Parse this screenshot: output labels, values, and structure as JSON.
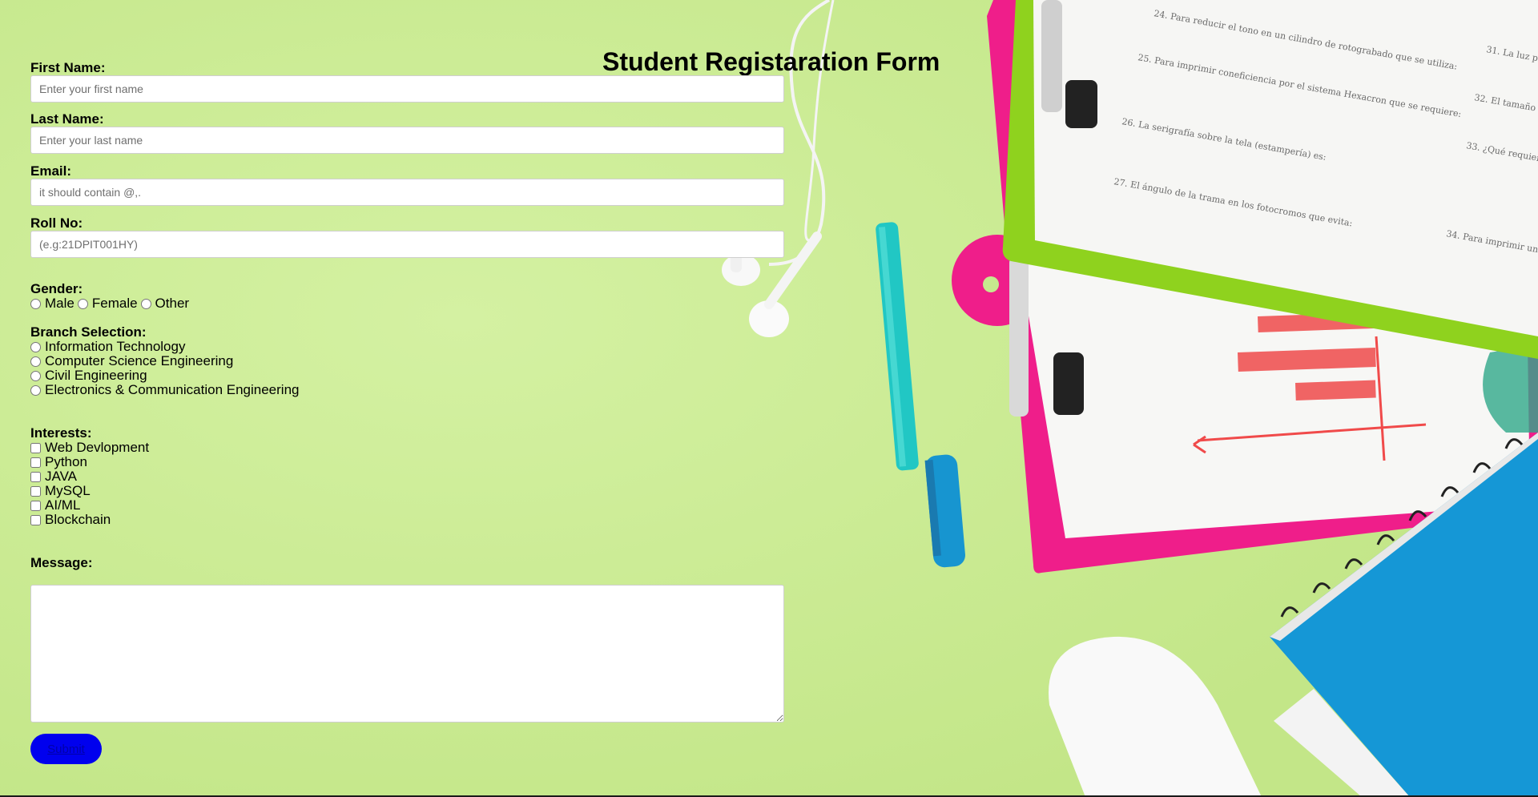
{
  "page": {
    "title": "Student Registaration Form"
  },
  "form": {
    "first_name": {
      "label": "First Name:",
      "placeholder": "Enter your first name",
      "value": ""
    },
    "last_name": {
      "label": "Last Name:",
      "placeholder": "Enter your last name",
      "value": ""
    },
    "email": {
      "label": "Email:",
      "placeholder": "it should contain @,.",
      "value": ""
    },
    "roll_no": {
      "label": "Roll No:",
      "placeholder": "(e.g:21DPIT001HY)",
      "value": ""
    },
    "gender": {
      "label": "Gender:",
      "options": [
        "Male",
        "Female",
        "Other"
      ]
    },
    "branch": {
      "label": "Branch Selection:",
      "options": [
        "Information Technology",
        "Computer Science Engineering",
        "Civil Engineering",
        "Electronics & Communication Engineering"
      ]
    },
    "interests": {
      "label": "Interests:",
      "options": [
        "Web Devlopment",
        "Python",
        "JAVA",
        "MySQL",
        "AI/ML",
        "Blockchain"
      ]
    },
    "message": {
      "label": "Message:",
      "value": ""
    },
    "submit_label": "Submit"
  },
  "colors": {
    "background": "#c6e98e",
    "submit_bg": "#0000ee"
  }
}
